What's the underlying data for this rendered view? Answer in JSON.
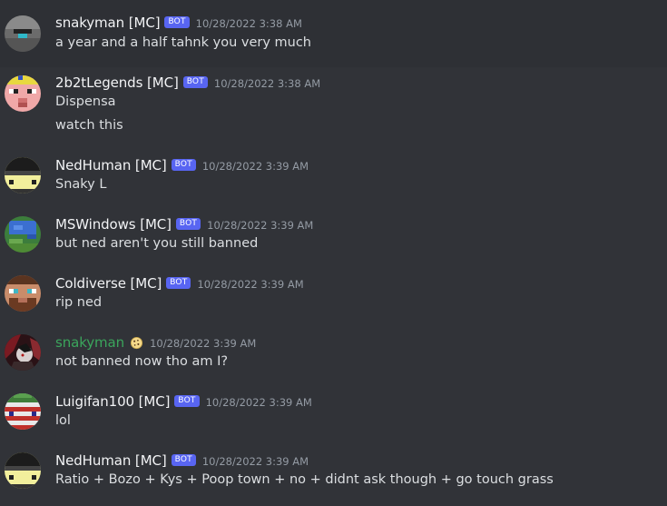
{
  "messages": [
    {
      "username": "snakyman [MC]",
      "bot": "BOT",
      "timestamp": "10/28/2022 3:38 AM",
      "lines": [
        "a year and a half tahnk you very much"
      ]
    },
    {
      "username": "2b2tLegends [MC]",
      "bot": "BOT",
      "timestamp": "10/28/2022 3:38 AM",
      "lines": [
        "Dispensa",
        "watch this"
      ]
    },
    {
      "username": "NedHuman [MC]",
      "bot": "BOT",
      "timestamp": "10/28/2022 3:39 AM",
      "lines": [
        "Snaky L"
      ]
    },
    {
      "username": "MSWindows [MC]",
      "bot": "BOT",
      "timestamp": "10/28/2022 3:39 AM",
      "lines": [
        "but ned aren't you still banned"
      ]
    },
    {
      "username": "Coldiverse [MC]",
      "bot": "BOT",
      "timestamp": "10/28/2022 3:39 AM",
      "lines": [
        "rip ned"
      ]
    },
    {
      "username": "snakyman",
      "timestamp": "10/28/2022 3:39 AM",
      "lines": [
        "not banned now tho am I?"
      ]
    },
    {
      "username": "Luigifan100 [MC]",
      "bot": "BOT",
      "timestamp": "10/28/2022 3:39 AM",
      "lines": [
        "lol"
      ]
    },
    {
      "username": "NedHuman [MC]",
      "bot": "BOT",
      "timestamp": "10/28/2022 3:39 AM",
      "lines": [
        "Ratio + Bozo + Kys + Poop town + no + didnt ask though + go touch grass"
      ]
    }
  ],
  "colors": {
    "background": "#313338",
    "username_default": "#f2f3f5",
    "username_snakyman": "#3ba55c",
    "bot_tag": "#5865f2",
    "timestamp": "#949ba4",
    "message_text": "#dbdee1"
  }
}
